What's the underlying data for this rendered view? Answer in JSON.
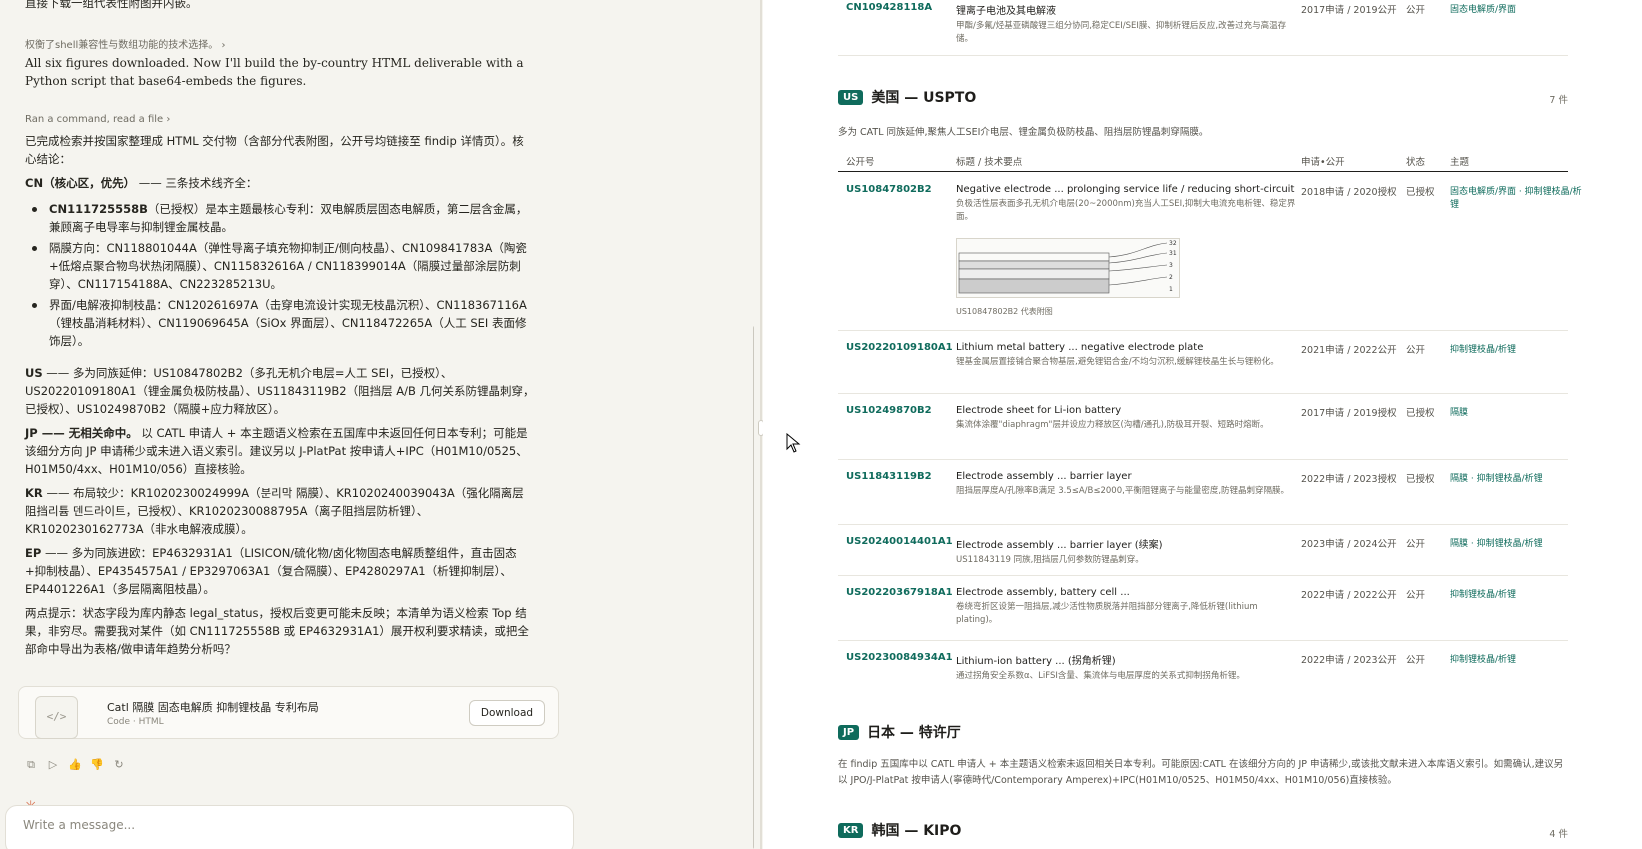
{
  "chat": {
    "top_cut": "直接下载一组代表性附图并内嵌。",
    "meta1": "权衡了shell兼容性与数组功能的技术选择。",
    "en_note": "All six figures downloaded. Now I'll build the by-country HTML deliverable with a Python script that base64-embeds the figures.",
    "meta2": "Ran a command, read a file",
    "summary_intro": "已完成检索并按国家整理成 HTML 交付物（含部分代表附图，公开号均链接至 findip 详情页）。核心结论：",
    "cn_head": "CN（核心区，优先）",
    "cn_tail": "—— 三条技术线齐全：",
    "cn_items": [
      {
        "bold": "CN111725558B",
        "text": "（已授权）是本主题最核心专利：双电解质层固态电解质，第二层含金属，兼顾离子电导率与抑制锂金属枝晶。"
      },
      {
        "bold": "",
        "text": "隔膜方向：CN118801044A（弹性导离子填充物抑制正/侧向枝晶）、CN109841783A（陶瓷+低熔点聚合物鸟状热闭隔膜）、CN115832616A / CN118399014A（隔膜过量部涂层防刺穿）、CN117154188A、CN223285213U。"
      },
      {
        "bold": "",
        "text": "界面/电解液抑制枝晶：CN120261697A（击穿电流设计实现无枝晶沉积）、CN118367116A（锂枝晶消耗材料）、CN119069645A（SiOx 界面层）、CN118472265A（人工 SEI 表面修饰层）。"
      }
    ],
    "us_head": "US",
    "us_text": "—— 多为同族延伸：US10847802B2（多孔无机介电层=人工 SEI，已授权）、US20220109180A1（锂金属负极防枝晶）、US11843119B2（阻挡层 A/B 几何关系防锂晶刺穿，已授权）、US10249870B2（隔膜+应力释放区）。",
    "jp_head": "JP —— 无相关命中。",
    "jp_text": "以 CATL 申请人 + 本主题语义检索在五国库中未返回任何日本专利；可能是该细分方向 JP 申请稀少或未进入语义索引。建议另以 J-PlatPat 按申请人+IPC（H01M10/0525、H01M50/4xx、H01M10/056）直接核验。",
    "kr_head": "KR",
    "kr_text": "—— 布局较少：KR1020230024999A（분리막 隔膜）、KR1020240039043A（强化隔离层 阻挡리튬 덴드라이트，已授权）、KR1020230088795A（离子阻挡层防析锂）、KR1020230162773A（非水电解液成膜）。",
    "ep_head": "EP",
    "ep_text": "—— 多为同族进欧：EP4632931A1（LISICON/硫化物/卤化物固态电解质整组件，直击固态+抑制枝晶）、EP4354575A1 / EP3297063A1（复合隔膜）、EP4280297A1（析锂抑制层）、EP4401226A1（多层隔离阻枝晶）。",
    "closing": "两点提示：状态字段为库内静态 legal_status，授权后变更可能未反映；本清单为语义检索 Top 结果，非穷尽。需要我对某件（如 CN111725558B 或 EP4632931A1）展开权利要求精读，或把全部命中导出为表格/做申请年趋势分析吗？"
  },
  "artifact": {
    "title": "Catl 隔膜 固态电解质 抑制锂枝晶 专利布局",
    "subtitle": "Code · HTML",
    "download": "Download"
  },
  "actions": [
    "copy-icon",
    "play-icon",
    "thumbs-up-icon",
    "thumbs-down-icon",
    "retry-icon"
  ],
  "composer": {
    "placeholder": "Write a message..."
  },
  "report": {
    "top_row": {
      "pn": "CN109428118A",
      "title": "锂离子电池及其电解液",
      "desc": "甲酯/多氟/烃基亚磷酸锂三组分协同,稳定CEI/SEI膜、抑制析锂后反应,改善过充与高温存储。",
      "dates": "2017申请 / 2019公开",
      "status": "公开",
      "topic": "固态电解质/界面"
    },
    "us": {
      "badge": "US",
      "title": "美国 — USPTO",
      "count": "7 件",
      "desc": "多为 CATL 同族延伸,聚焦人工SEI介电层、锂金属负极防枝晶、阻挡层防锂晶刺穿隔膜。",
      "headers": [
        "公开号",
        "标题 / 技术要点",
        "申请•公开",
        "状态",
        "主题"
      ],
      "rows": [
        {
          "pn": "US10847802B2",
          "title": "Negative electrode ... prolonging service life / reducing short-circuit",
          "desc": "负极活性层表面多孔无机介电层(20~2000nm)充当人工SEI,抑制大电流充电析锂、稳定界面。",
          "dates": "2018申请 / 2020授权",
          "status": "已授权",
          "topic": "固态电解质/界面 · 抑制锂枝晶/析锂",
          "fig_caption": "US10847802B2 代表附图",
          "fig_labels": [
            "32",
            "31",
            "3",
            "2",
            "1"
          ]
        },
        {
          "pn": "US20220109180A1",
          "title": "Lithium metal battery ... negative electrode plate",
          "desc": "锂基金属层置接铺合聚合物基层,避免锂铝合金/不均匀沉积,缓解锂枝晶生长与锂粉化。",
          "dates": "2021申请 / 2022公开",
          "status": "公开",
          "topic": "抑制锂枝晶/析锂"
        },
        {
          "pn": "US10249870B2",
          "title": "Electrode sheet for Li-ion battery",
          "desc": "集流体涂覆\"diaphragm\"层并设应力释放区(沟槽/通孔),防极耳开裂、短路时熔断。",
          "dates": "2017申请 / 2019授权",
          "status": "已授权",
          "topic": "隔膜"
        },
        {
          "pn": "US11843119B2",
          "title": "Electrode assembly ... barrier layer",
          "desc": "阻挡层厚度A/孔隙率B满足 3.5≤A/B≤2000,平衡阻锂离子与能量密度,防锂晶刺穿隔膜。",
          "dates": "2022申请 / 2023授权",
          "status": "已授权",
          "topic": "隔膜 · 抑制锂枝晶/析锂"
        },
        {
          "pn": "US20240014401A1",
          "title": "Electrode assembly ... barrier layer (续案)",
          "desc": "US11843119 同族,阻挡层几何参数防锂晶刺穿。",
          "dates": "2023申请 / 2024公开",
          "status": "公开",
          "topic": "隔膜 · 抑制锂枝晶/析锂"
        },
        {
          "pn": "US20220367918A1",
          "title": "Electrode assembly, battery cell ...",
          "desc": "卷绕弯折区设第一阻挡层,减少活性物质脱落并阻挡部分锂离子,降低析锂(lithium plating)。",
          "dates": "2022申请 / 2022公开",
          "status": "公开",
          "topic": "抑制锂枝晶/析锂"
        },
        {
          "pn": "US20230084934A1",
          "title": "Lithium-ion battery ... (拐角析锂)",
          "desc": "通过拐角安全系数α、LiFSI含量、集流体与电层厚度的关系式抑制拐角析锂。",
          "dates": "2022申请 / 2023公开",
          "status": "公开",
          "topic": "抑制锂枝晶/析锂"
        }
      ]
    },
    "jp": {
      "badge": "JP",
      "title": "日本 — 特许厅",
      "desc": "在 findip 五国库中以 CATL 申请人 + 本主题语义检索未返回相关日本专利。可能原因:CATL 在该细分方向的 JP 申请稀少,或该批文献未进入本库语义索引。如需确认,建议另以 JPO/J-PlatPat 按申请人(寧德時代/Contemporary Amperex)+IPC(H01M10/0525、H01M50/4xx、H01M10/056)直接核验。"
    },
    "kr": {
      "badge": "KR",
      "title": "韩国 — KIPO",
      "count": "4 件"
    }
  }
}
